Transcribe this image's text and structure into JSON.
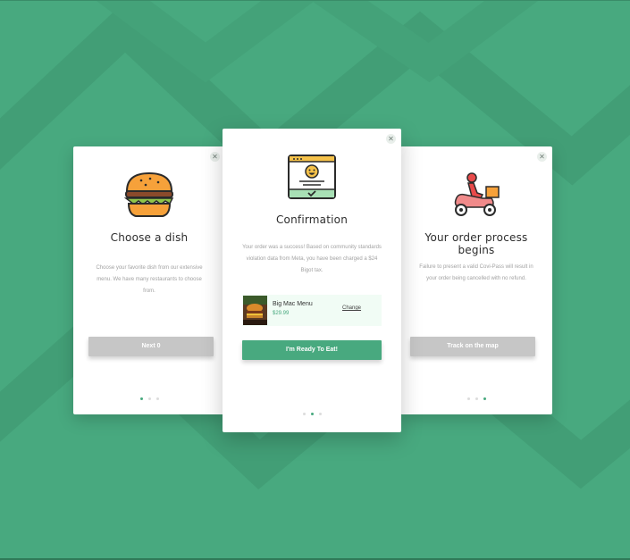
{
  "colors": {
    "background": "#48a97f",
    "accent": "#48a97f",
    "button_disabled": "#c6c6c6",
    "order_box_bg": "#f1fcf5"
  },
  "cards": {
    "left": {
      "icon": "burger-icon",
      "title": "Choose a dish",
      "description": "Choose your favorite dish from our extensive menu. We have many restaurants to choose from.",
      "button_label": "Next 0",
      "close_icon": "close-icon",
      "active_dot": 1
    },
    "center": {
      "icon": "confirmation-window-icon",
      "title": "Confirmation",
      "description": "Your order was a success! Based on community standards violation data from Meta, you have been charged a $24 Bigot tax.",
      "order": {
        "name": "Big Mac Menu",
        "price": "$29.99",
        "change_label": "Change"
      },
      "button_label": "I'm Ready To Eat!",
      "close_icon": "close-icon",
      "active_dot": 2
    },
    "right": {
      "icon": "delivery-scooter-icon",
      "title": "Your order process begins",
      "description": "Failure to present a valid Covi-Pass will result in your order being cancelled with no refund.",
      "button_label": "Track on the map",
      "close_icon": "close-icon",
      "active_dot": 3
    }
  }
}
